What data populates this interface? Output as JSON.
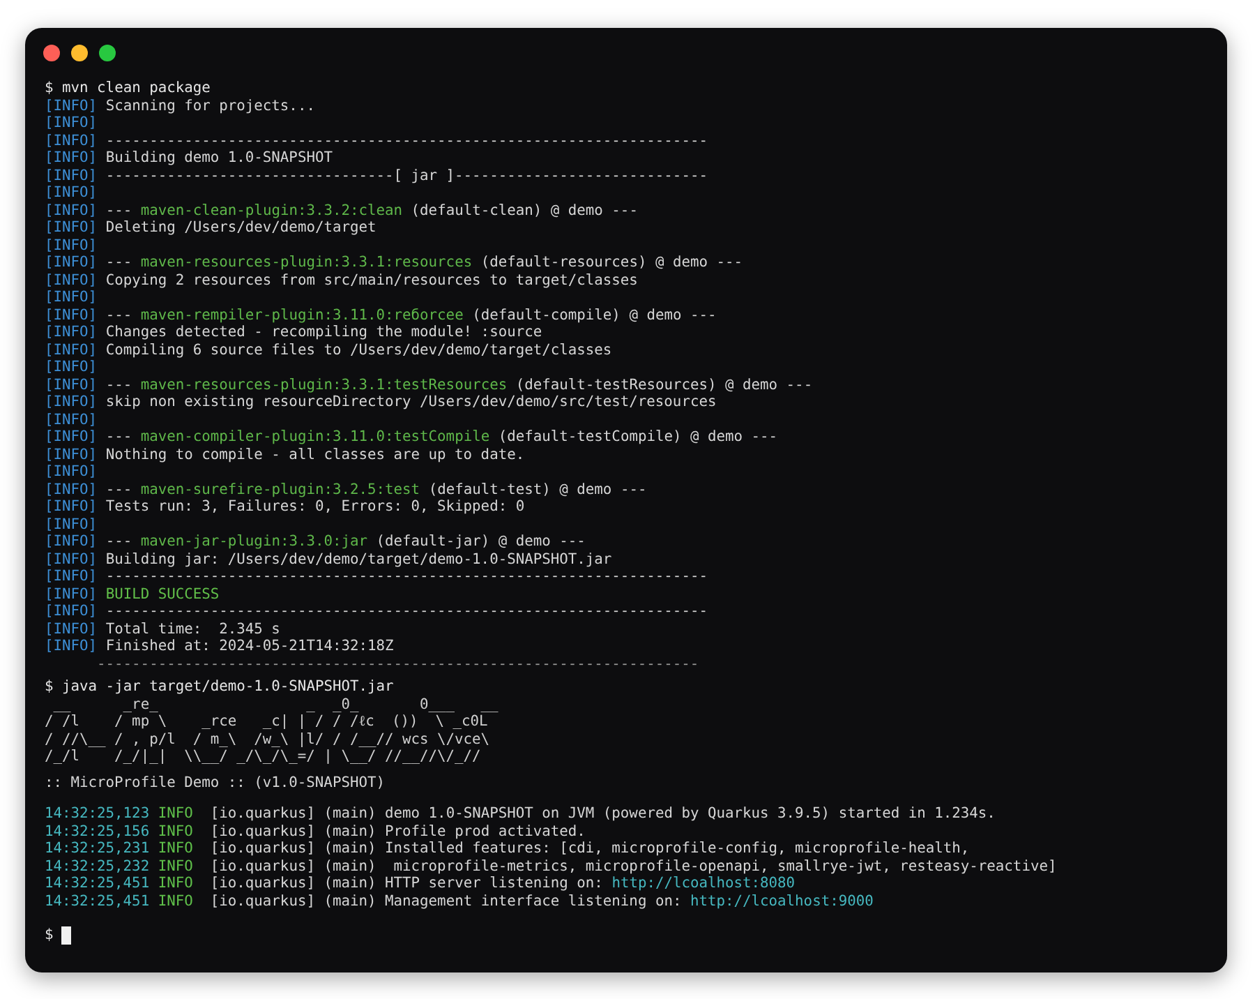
{
  "window": {
    "controls": [
      {
        "color": "#fe5f57"
      },
      {
        "color": "#febc2e"
      },
      {
        "color": "#28c840"
      }
    ]
  },
  "lines": [
    {
      "kind": "prompt",
      "prompt": "$",
      "command": "mvn clean package"
    },
    {
      "kind": "info",
      "tag": "[INFO]",
      "text": "Scanning for projects..."
    },
    {
      "kind": "info",
      "tag": "[INFO]"
    },
    {
      "kind": "info",
      "tag": "[INFO]",
      "text": "---------------------------------------------------------------------"
    },
    {
      "kind": "info",
      "tag": "[INFO]",
      "text": "Building demo 1.0-SNAPSHOT"
    },
    {
      "kind": "info",
      "tag": "[INFO]",
      "text": "---------------------------------[ jar ]-----------------------------"
    },
    {
      "kind": "info",
      "tag": "[INFO]"
    },
    {
      "kind": "info",
      "tag": "[INFO]",
      "lead": "---",
      "plugin": "maven-clean-plugin:3.3.2:clean",
      "text": "(default-clean) @ demo ---"
    },
    {
      "kind": "info",
      "tag": "[INFO]",
      "text": "Deleting /Users/dev/demo/target"
    },
    {
      "kind": "info",
      "tag": "[INFO]"
    },
    {
      "kind": "info",
      "tag": "[INFO]",
      "lead": "---",
      "plugin": "maven-resources-plugin:3.3.1:resources",
      "text": "(default-resources) @ demo ---"
    },
    {
      "kind": "info",
      "tag": "[INFO]",
      "text": "Copying 2 resources from src/main/resources to target/classes"
    },
    {
      "kind": "info",
      "tag": "[INFO]"
    },
    {
      "kind": "info",
      "tag": "[INFO]",
      "lead": "---",
      "plugin": "maven-rempiler-plugin:3.11.0:reбorcee",
      "text": "(default-compile) @ demo ---"
    },
    {
      "kind": "info",
      "tag": "[INFO]",
      "text": "Changes detected - recompiling the module! :source"
    },
    {
      "kind": "info",
      "tag": "[INFO]",
      "text": "Compiling 6 source files to /Users/dev/demo/target/classes"
    },
    {
      "kind": "info",
      "tag": "[INFO]"
    },
    {
      "kind": "info",
      "tag": "[INFO]",
      "lead": "---",
      "plugin": "maven-resources-plugin:3.3.1:testResources",
      "text": "(default-testResources) @ demo ---"
    },
    {
      "kind": "info",
      "tag": "[INFO]",
      "text": "skip non existing resourceDirectory /Users/dev/demo/src/test/resources"
    },
    {
      "kind": "info",
      "tag": "[INFO]"
    },
    {
      "kind": "info",
      "tag": "[INFO]",
      "lead": "---",
      "plugin": "maven-compiler-plugin:3.11.0:testCompile",
      "text": "(default-testCompile) @ demo ---"
    },
    {
      "kind": "info",
      "tag": "[INFO]",
      "text": "Nothing to compile - all classes are up to date."
    },
    {
      "kind": "info",
      "tag": "[INFO]"
    },
    {
      "kind": "info",
      "tag": "[INFO]",
      "lead": "---",
      "plugin": "maven-surefire-plugin:3.2.5:test",
      "text": "(default-test) @ demo ---"
    },
    {
      "kind": "info",
      "tag": "[INFO]",
      "text": "Tests run: 3, Failures: 0, Errors: 0, Skipped: 0"
    },
    {
      "kind": "info",
      "tag": "[INFO]"
    },
    {
      "kind": "info",
      "tag": "[INFO]",
      "lead": "---",
      "plugin": "maven-jar-plugin:3.3.0:jar",
      "text": "(default-jar) @ demo ---"
    },
    {
      "kind": "info",
      "tag": "[INFO]",
      "text": "Building jar: /Users/dev/demo/target/demo-1.0-SNAPSHOT.jar"
    },
    {
      "kind": "info",
      "tag": "[INFO]",
      "text": "---------------------------------------------------------------------"
    },
    {
      "kind": "success",
      "tag": "[INFO]",
      "text": "BUILD SUCCESS"
    },
    {
      "kind": "info",
      "tag": "[INFO]",
      "text": "---------------------------------------------------------------------"
    },
    {
      "kind": "info",
      "tag": "[INFO]",
      "text": "Total time:  2.345 s"
    },
    {
      "kind": "info",
      "tag": "[INFO]",
      "text": "Finished at: 2024-05-21T14:32:18Z"
    },
    {
      "kind": "rule",
      "text": "---------------------------------------------------------------------"
    },
    {
      "kind": "prompt",
      "prompt": "$",
      "command": "java -jar target/demo-1.0-SNAPSHOT.jar"
    },
    {
      "kind": "ascii",
      "text": " __      _re_                 _  _0_       0___   __"
    },
    {
      "kind": "ascii",
      "text": "/ /l    / mp \\    _rce   _c| | / / /ℓc  ())  \\ _c0L"
    },
    {
      "kind": "ascii",
      "text": "/ //\\__ / , p/l  / m_\\  /w_\\ |l/ / /__// wcs \\/vce\\"
    },
    {
      "kind": "ascii",
      "text": "/_/l    /_/|_|  \\\\__/ _/\\_/\\_=/ | \\__/ //__//\\/_//"
    },
    {
      "kind": "banner",
      "text": ":: MicroProfile Demo :: (v1.0-SNAPSHOT)"
    },
    {
      "kind": "log",
      "time": "14:32:25,123",
      "level": "INFO",
      "logger": "[io.quarkus]",
      "message": "(main) demo 1.0-SNAPSHOT on JVM (powered by Quarkus 3.9.5) started in 1.234s."
    },
    {
      "kind": "log",
      "time": "14:32:25,156",
      "level": "INFO",
      "logger": "[io.quarkus]",
      "message": "(main) Profile prod activated."
    },
    {
      "kind": "log",
      "time": "14:32:25,231",
      "level": "INFO",
      "logger": "[io.quarkus]",
      "message": "(main) Installed features: [cdi, microprofile-config, microprofile-health,"
    },
    {
      "kind": "log",
      "time": "14:32:25,232",
      "level": "INFO",
      "logger": "[io.quarkus]",
      "message": "(main)  microprofile-metrics, microprofile-openapi, smallrye-jwt, resteasy-reactive]"
    },
    {
      "kind": "log",
      "time": "14:32:25,451",
      "level": "INFO",
      "logger": "[io.quarkus]",
      "message": "(main) HTTP server listening on:",
      "link": "http://lcoalhost:8080"
    },
    {
      "kind": "log",
      "time": "14:32:25,451",
      "level": "INFO",
      "logger": "[io.quarkus]",
      "message": "(main) Management interface listening on:",
      "link": "http://lcoalhost:9000"
    },
    {
      "kind": "cursor",
      "prompt": "$",
      "cursor": true
    }
  ]
}
